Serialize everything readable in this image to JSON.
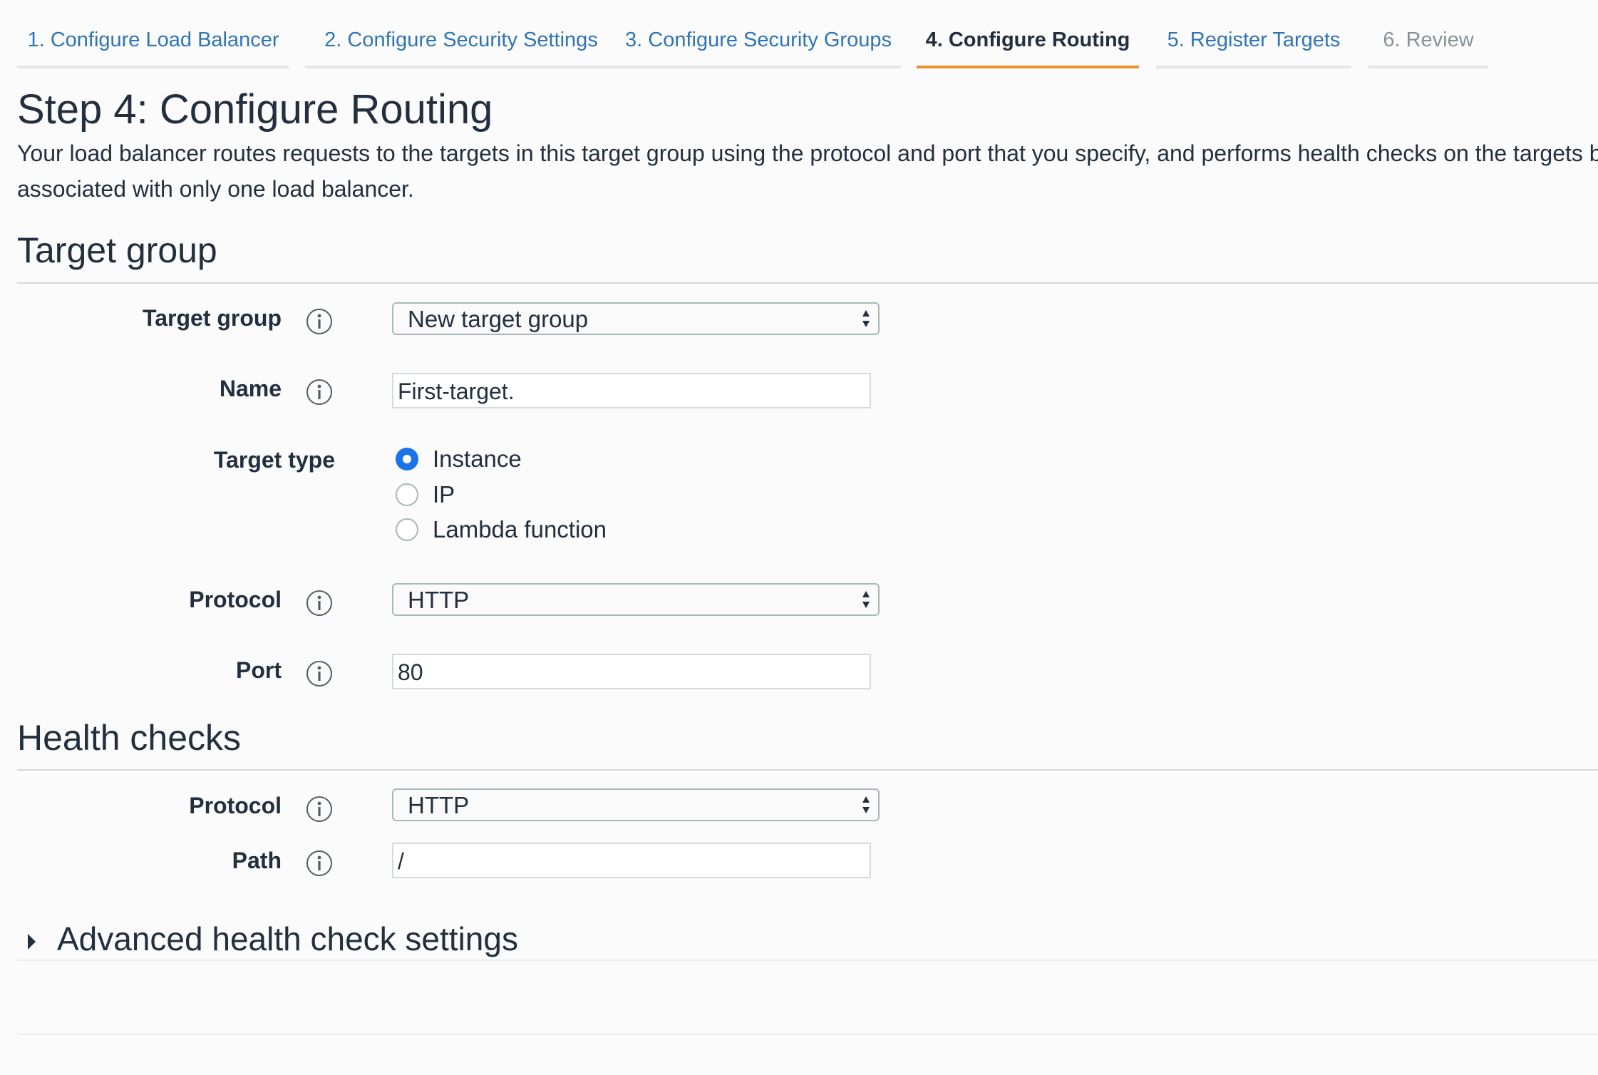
{
  "wizard": {
    "tabs": [
      {
        "label": "1. Configure Load Balancer",
        "state": "link"
      },
      {
        "label": "2. Configure Security Settings",
        "state": "link"
      },
      {
        "label": "3. Configure Security Groups",
        "state": "link"
      },
      {
        "label": "4. Configure Routing",
        "state": "active"
      },
      {
        "label": "5. Register Targets",
        "state": "link"
      },
      {
        "label": "6. Review",
        "state": "disabled"
      }
    ]
  },
  "page": {
    "title": "Step 4: Configure Routing",
    "description": "Your load balancer routes requests to the targets in this target group using the protocol and port that you specify, and performs health checks on the targets be associated with only one load balancer."
  },
  "target_group_section": {
    "title": "Target group",
    "target_group": {
      "label": "Target group",
      "value": "New target group"
    },
    "name": {
      "label": "Name",
      "value": "First-target."
    },
    "target_type": {
      "label": "Target type",
      "options": [
        "Instance",
        "IP",
        "Lambda function"
      ],
      "selected": "Instance"
    },
    "protocol": {
      "label": "Protocol",
      "value": "HTTP"
    },
    "port": {
      "label": "Port",
      "value": "80"
    }
  },
  "health_checks_section": {
    "title": "Health checks",
    "protocol": {
      "label": "Protocol",
      "value": "HTTP"
    },
    "path": {
      "label": "Path",
      "value": "/"
    },
    "advanced_label": "Advanced health check settings"
  },
  "colors": {
    "accent_tab_underline": "#ec912d",
    "link": "#2f75b5",
    "radio_selected": "#1a73e8",
    "text": "#232f3e"
  },
  "icons": {
    "info": "info-icon",
    "select_arrows": "select-arrows-icon",
    "expand": "caret-right-icon"
  }
}
